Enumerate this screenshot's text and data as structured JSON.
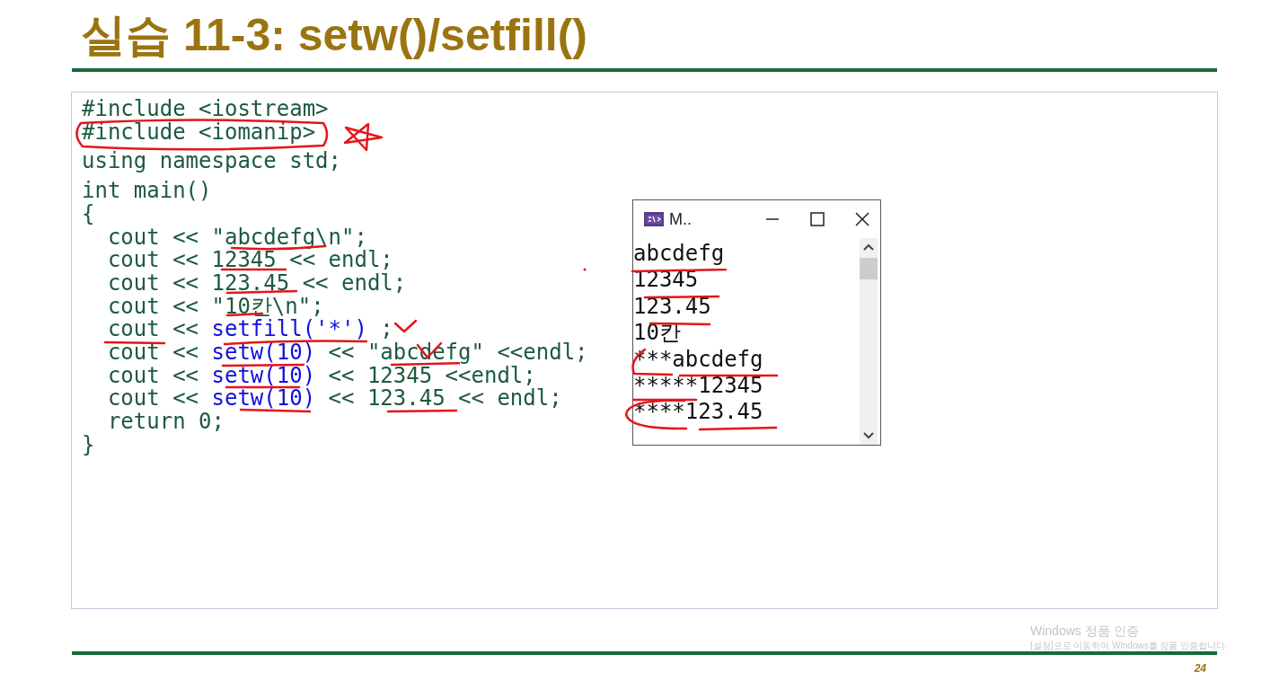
{
  "title": "실습 11-3: setw()/setfill()",
  "code_lines": [
    [
      {
        "kind": "plain",
        "text": "#include <iostream>"
      }
    ],
    [
      {
        "kind": "plain",
        "text": "#include <iomanip>"
      }
    ],
    [
      {
        "kind": "plain",
        "text": "using namespace std;"
      }
    ],
    [
      {
        "kind": "plain",
        "text": "int main()"
      }
    ],
    [
      {
        "kind": "plain",
        "text": "{"
      }
    ],
    [
      {
        "kind": "plain",
        "text": "  cout << \"abcdefg\\n\";"
      }
    ],
    [
      {
        "kind": "plain",
        "text": "  cout << 12345 << endl;"
      }
    ],
    [
      {
        "kind": "plain",
        "text": "  cout << 123.45 << endl;"
      }
    ],
    [
      {
        "kind": "plain",
        "text": "  cout << \"10칸\\n\";"
      }
    ],
    [
      {
        "kind": "plain",
        "text": "  cout << "
      },
      {
        "kind": "function",
        "text": "setfill('*')"
      },
      {
        "kind": "plain",
        "text": " ;"
      }
    ],
    [
      {
        "kind": "plain",
        "text": "  cout << "
      },
      {
        "kind": "function",
        "text": "setw(10)"
      },
      {
        "kind": "plain",
        "text": " << \"abcdefg\" <<endl;"
      }
    ],
    [
      {
        "kind": "plain",
        "text": "  cout << "
      },
      {
        "kind": "function",
        "text": "setw(10)"
      },
      {
        "kind": "plain",
        "text": " << 12345 <<endl;"
      }
    ],
    [
      {
        "kind": "plain",
        "text": "  cout << "
      },
      {
        "kind": "function",
        "text": "setw(10)"
      },
      {
        "kind": "plain",
        "text": " << 123.45 << endl;"
      }
    ],
    [
      {
        "kind": "plain",
        "text": "  return 0;"
      }
    ],
    [
      {
        "kind": "plain",
        "text": "}"
      }
    ]
  ],
  "console": {
    "title": "M..",
    "lines": [
      "abcdefg",
      "12345",
      "123.45",
      "10칸",
      "***abcdefg",
      "*****12345",
      "****123.45"
    ]
  },
  "activation_notice": {
    "title": "Windows 정품 인증",
    "message": "[설정]으로 이동하여 Windows를 정품 인증합니다."
  },
  "page_number": "24"
}
